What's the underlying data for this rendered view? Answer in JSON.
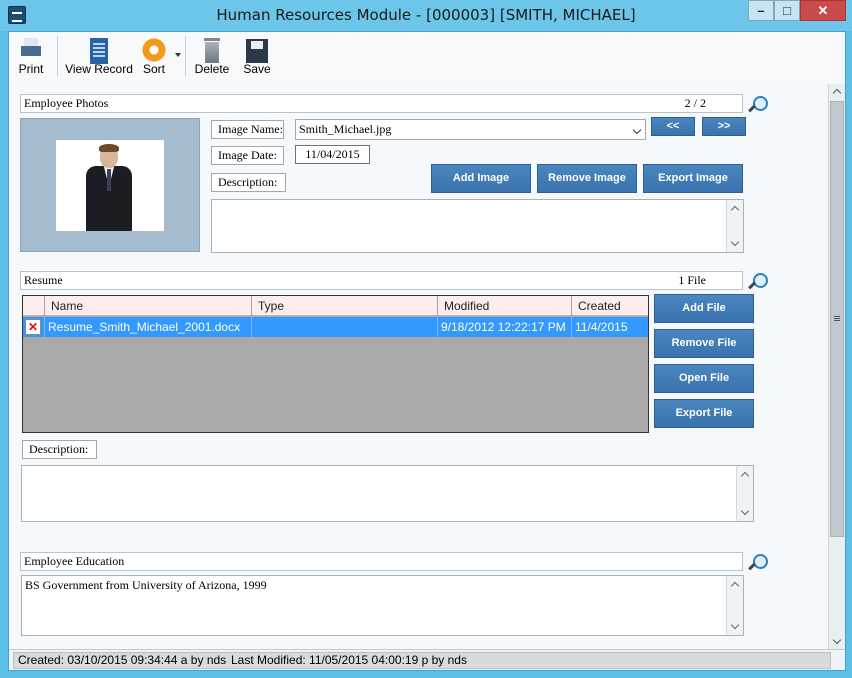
{
  "window": {
    "title": "Human Resources Module - [000003] [SMITH, MICHAEL]",
    "min_glyph": "–",
    "max_glyph": "□",
    "close_glyph": "✕"
  },
  "toolbar": {
    "print": "Print",
    "view_record": "View Record",
    "sort": "Sort",
    "delete": "Delete",
    "save": "Save"
  },
  "photos": {
    "section_title": "Employee Photos",
    "count": "2 / 2",
    "image_name_label": "Image Name:",
    "image_name_value": "Smith_Michael.jpg",
    "image_date_label": "Image Date:",
    "image_date_value": "11/04/2015",
    "description_label": "Description:",
    "description_value": "",
    "prev_label": "<<",
    "next_label": ">>",
    "add_image": "Add Image",
    "remove_image": "Remove Image",
    "export_image": "Export Image"
  },
  "resume": {
    "section_title": "Resume",
    "count": "1 File",
    "columns": [
      "Name",
      "Type",
      "Modified",
      "Created"
    ],
    "rows": [
      {
        "name": "Resume_Smith_Michael_2001.docx",
        "type": "",
        "modified": "9/18/2012 12:22:17 PM",
        "created": "11/4/2015",
        "row_marker": "✕"
      }
    ],
    "add_file": "Add File",
    "remove_file": "Remove File",
    "open_file": "Open File",
    "export_file": "Export File",
    "description_label": "Description:",
    "description_value": ""
  },
  "education": {
    "section_title": "Employee Education",
    "text": "BS Government from University of Arizona, 1999"
  },
  "status": {
    "created": "Created: 03/10/2015 09:34:44 a by nds",
    "modified": "Last Modified: 11/05/2015 04:00:19 p by nds"
  }
}
